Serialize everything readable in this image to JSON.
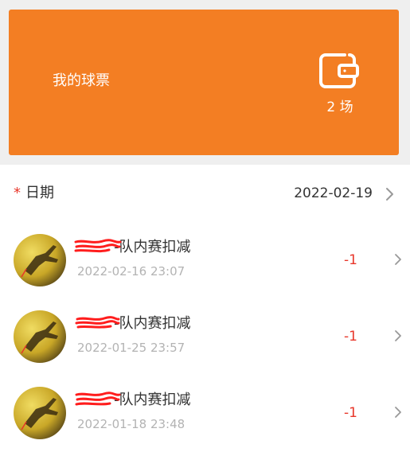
{
  "ticket_card": {
    "title": "我的球票",
    "count": "2 场",
    "icon": "wallet-icon",
    "bg_color": "#f37e23"
  },
  "date_field": {
    "required_mark": "*",
    "label": "日期",
    "value": "2022-02-19",
    "icon": "chevron-right-icon"
  },
  "records": [
    {
      "title": "-队内赛扣减",
      "time": "2022-02-16 23:07",
      "delta": "-1"
    },
    {
      "title": "-队内赛扣减",
      "time": "2022-01-25 23:57",
      "delta": "-1"
    },
    {
      "title": "-队内赛扣减",
      "time": "2022-01-18 23:48",
      "delta": "-1"
    }
  ],
  "colors": {
    "accent": "#f37e23",
    "danger": "#e8362a",
    "muted": "#b3b3b3"
  }
}
